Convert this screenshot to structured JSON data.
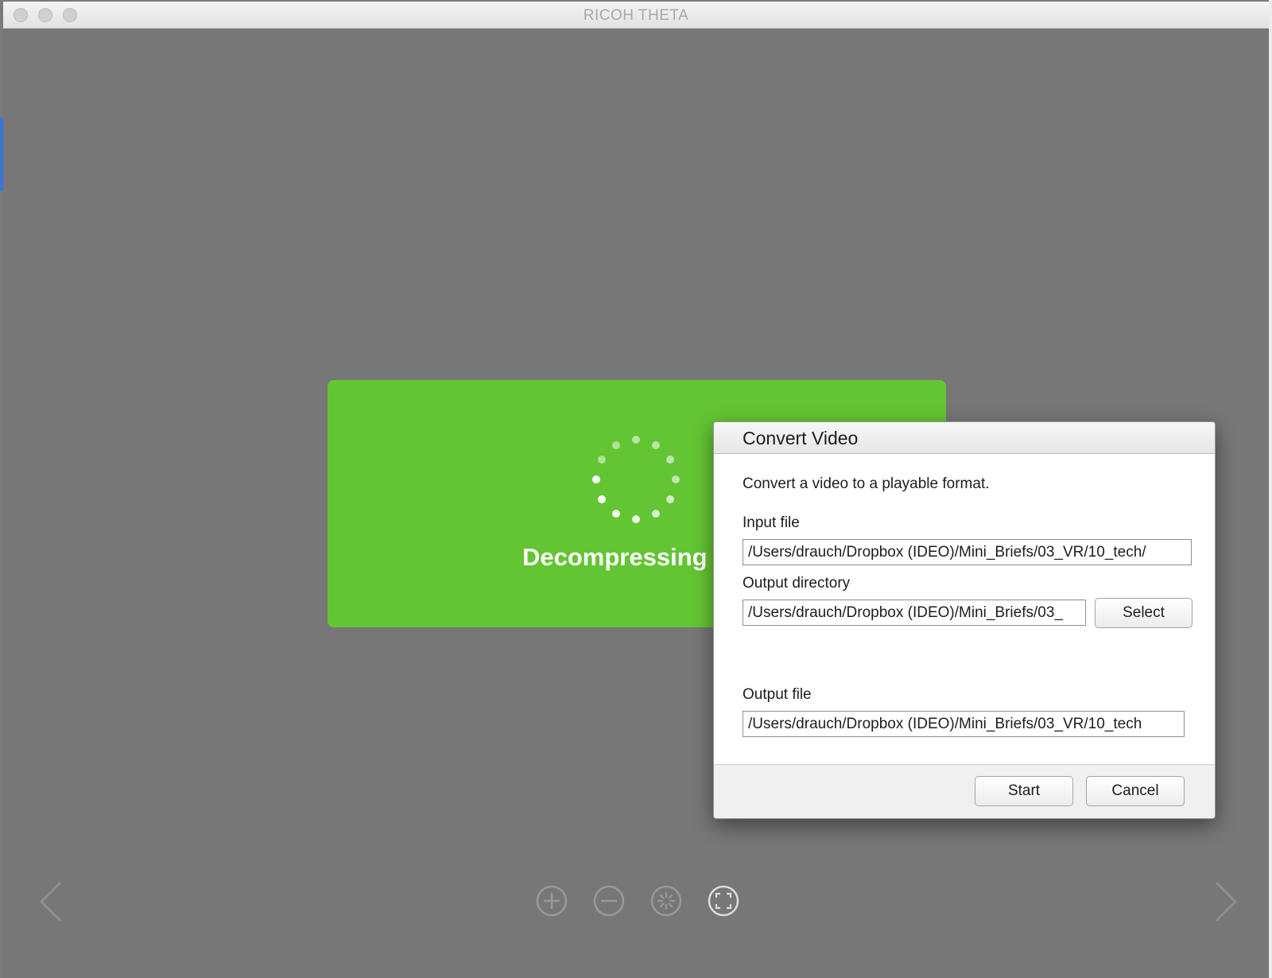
{
  "window": {
    "title": "RICOH THETA"
  },
  "panel": {
    "status_text": "Decompressing"
  },
  "dialog": {
    "title": "Convert Video",
    "description": "Convert a video to a playable format.",
    "input_file_label": "Input file",
    "input_file_value": "/Users/drauch/Dropbox (IDEO)/Mini_Briefs/03_VR/10_tech/",
    "output_dir_label": "Output directory",
    "output_dir_value": "/Users/drauch/Dropbox (IDEO)/Mini_Briefs/03_",
    "select_label": "Select",
    "output_file_label": "Output file",
    "output_file_value": "/Users/drauch/Dropbox (IDEO)/Mini_Briefs/03_VR/10_tech",
    "start_label": "Start",
    "cancel_label": "Cancel"
  },
  "toolbar": {
    "icons": [
      "zoom-in-icon",
      "zoom-out-icon",
      "reset-view-icon",
      "fullscreen-icon"
    ]
  },
  "colors": {
    "panel_green": "#63c533",
    "viewer_background": "#777777",
    "icon_gray": "#9a9a9a"
  }
}
